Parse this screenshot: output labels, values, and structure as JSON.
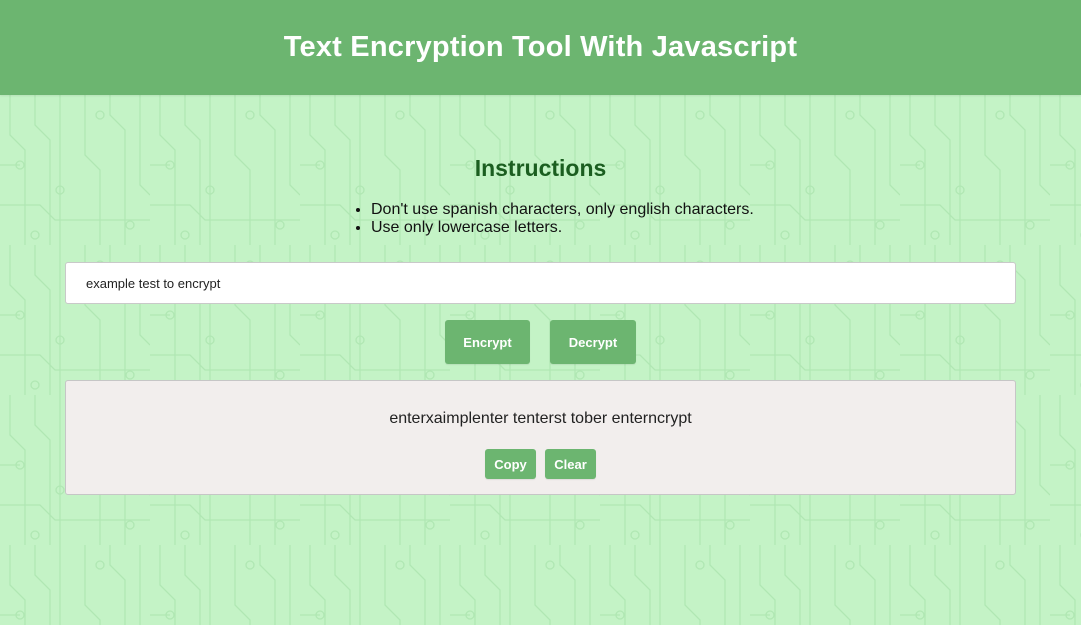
{
  "header": {
    "title": "Text Encryption Tool With Javascript"
  },
  "instructions": {
    "title": "Instructions",
    "items": [
      "Don't use spanish characters, only english characters.",
      "Use only lowercase letters."
    ]
  },
  "input": {
    "value": "example test to encrypt"
  },
  "actions": {
    "encrypt_label": "Encrypt",
    "decrypt_label": "Decrypt"
  },
  "result": {
    "text": "enterxaimplenter tenterst tober enterncrypt",
    "copy_label": "Copy",
    "clear_label": "Clear"
  },
  "colors": {
    "header_bg": "#6cb570",
    "page_bg": "#c4f3c6",
    "accent": "#6cb570",
    "heading": "#1b5e20",
    "result_bg": "#f2eeed"
  }
}
